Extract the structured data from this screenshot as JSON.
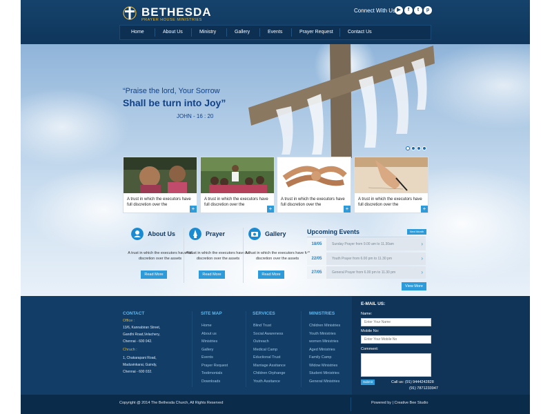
{
  "header": {
    "logo_title": "BETHESDA",
    "logo_subtitle": "PRAYER HOUSE MINISTRIES",
    "connect_label": "Connect With Us",
    "social": [
      {
        "icon": "youtube-icon",
        "glyph": "▶"
      },
      {
        "icon": "facebook-icon",
        "glyph": "f"
      },
      {
        "icon": "twitter-icon",
        "glyph": "t"
      },
      {
        "icon": "pinterest-icon",
        "glyph": "p"
      }
    ]
  },
  "nav": {
    "items": [
      "Home",
      "About Us",
      "Ministry",
      "Gallery",
      "Events",
      "Prayer Request",
      "Contact Us"
    ]
  },
  "hero": {
    "quote_line1": "“Praise the lord, Your Sorrow",
    "quote_line2": "Shall be turn into Joy”",
    "quote_ref": "JOHN - 16 : 20",
    "slide_count": 4,
    "active_slide": 1
  },
  "cards": [
    {
      "text": "A trust in which the executors have full discretion over the",
      "image": "children-photo"
    },
    {
      "text": "A trust in which the executors have full discretion over the",
      "image": "community-photo"
    },
    {
      "text": "A trust in which the executors have full discretion over the",
      "image": "joined-hands-photo"
    },
    {
      "text": "A trust in which the executors have full discretion over the",
      "image": "writing-hand-photo"
    }
  ],
  "features": [
    {
      "title": "About Us",
      "icon": "user-icon",
      "text": "A trust in which the executors have full discretion over the assets",
      "button": "Read More"
    },
    {
      "title": "Prayer",
      "icon": "praying-hands-icon",
      "text": "A trust in which the executors have full discretion over the assets",
      "button": "Read More"
    },
    {
      "title": "Gallery",
      "icon": "camera-icon",
      "text": "A trust in which the executors have full discretion over the assets",
      "button": "Read More"
    }
  ],
  "events": {
    "title": "Upcoming Events",
    "next_label": "Next Month",
    "items": [
      {
        "date": "18/05",
        "text": "Sunday Prayer from 9.00 am to 11.30am"
      },
      {
        "date": "22/05",
        "text": "Youth Prayer from 6.00 pm to 11.30 pm"
      },
      {
        "date": "27/05",
        "text": "General Prayer from 6.00 pm to 11.30 pm"
      }
    ],
    "view_more": "View More"
  },
  "footer": {
    "contact": {
      "heading": "CONTACT",
      "office_label": "Office :",
      "office_lines": [
        "13/6, Kannabiran Street,",
        "Gandhi Road,Velachery,",
        "Chennai - 600 042."
      ],
      "church_label": "Chruch :",
      "church_lines": [
        "1, Chakarapani Road,",
        "Maduvinkarai, Guindy,",
        "Chennai - 600 032."
      ]
    },
    "sitemap": {
      "heading": "SITE MAP",
      "links": [
        "Home",
        "About us",
        "Ministries",
        "Gallery",
        "Events",
        "Prayer Request",
        "Testimonials",
        "Downloads"
      ]
    },
    "services": {
      "heading": "SERVICES",
      "links": [
        "Blind Trust",
        "Social Awareness",
        "Outreach",
        "Medical Camp",
        "Eductional Trust",
        "Marriage Assitance",
        "Children Orphange",
        "Youth Assitance"
      ]
    },
    "ministries": {
      "heading": "MINISTRIES",
      "links": [
        "Children Ministries",
        "Youth Ministries",
        "women Ministries",
        "Aged Ministries",
        "Family Camp",
        "Widow Ministries",
        "Student Ministries",
        "General Ministries"
      ]
    },
    "email": {
      "heading": "E-MAIL US:",
      "name_label": "Name:",
      "name_placeholder": "Enter Your Name",
      "mobile_label": "Mobile No:",
      "mobile_placeholder": "Enter Your Mobile No",
      "comment_label": "Comment:",
      "submit": "Submit",
      "call_line1": "Call us: (91) 9444242828",
      "call_line2": "(91) 7871233947"
    }
  },
  "bottom": {
    "copyright": "Copyright @ 2014 The Bethesda Church, All Rights Reserved",
    "powered": "Powered by | Creative Bee Studio"
  }
}
